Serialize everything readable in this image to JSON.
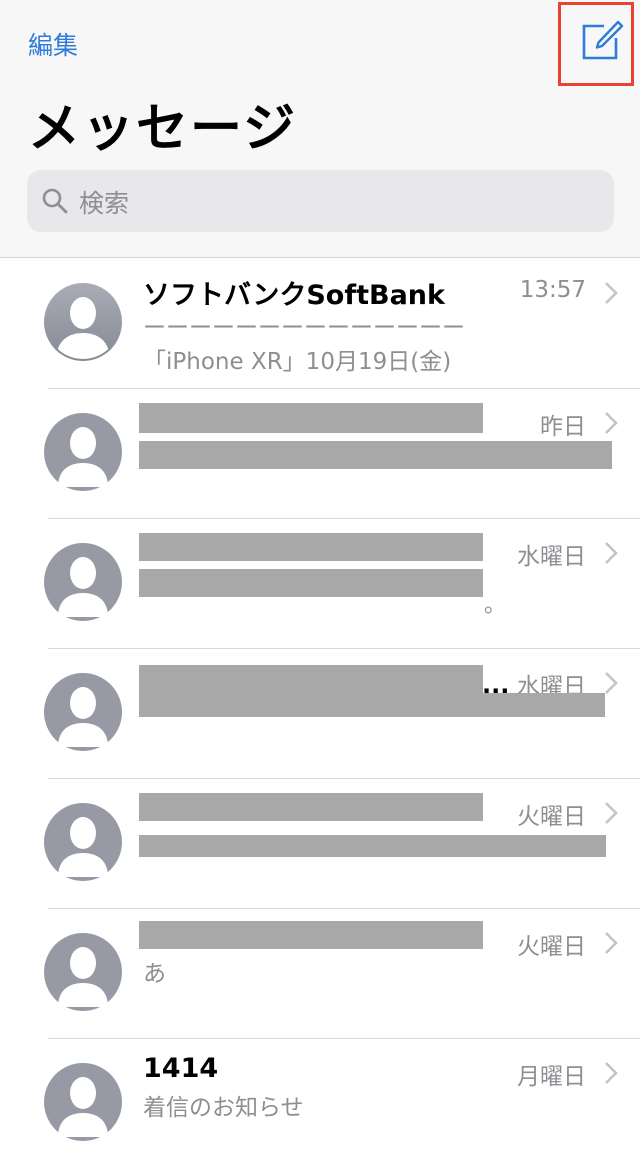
{
  "header": {
    "edit_label": "編集",
    "title": "メッセージ",
    "search_placeholder": "検索"
  },
  "colors": {
    "accent": "#2f7bd9",
    "highlight": "#e8432e",
    "secondary_text": "#8e8e93",
    "redaction": "#a8a8a8"
  },
  "conversations": [
    {
      "name": "ソフトバンクSoftBank",
      "time": "13:57",
      "preview_line1": "ーーーーーーーーーーーーーー",
      "preview_line2": "「iPhone XR」10月19日(金)"
    },
    {
      "name": "",
      "time": "昨日",
      "preview_line1": "",
      "preview_line2": ""
    },
    {
      "name": "",
      "time": "水曜日",
      "preview_line1": "",
      "preview_line2": "",
      "preview_tail": "。"
    },
    {
      "name": "",
      "time": "水曜日",
      "name_ellipsis": "...",
      "preview_line1": "",
      "preview_line2": ""
    },
    {
      "name": "",
      "time": "火曜日",
      "preview_line1": "",
      "preview_line2": ""
    },
    {
      "name": "",
      "time": "火曜日",
      "preview_line1": "あ",
      "preview_line2": ""
    },
    {
      "name": "1414",
      "time": "月曜日",
      "preview_line1": "着信のお知らせ",
      "preview_line2": ""
    }
  ],
  "icons": {
    "compose": "compose-icon",
    "search": "search-icon",
    "avatar": "person-avatar-icon",
    "chevron": "chevron-right-icon"
  }
}
